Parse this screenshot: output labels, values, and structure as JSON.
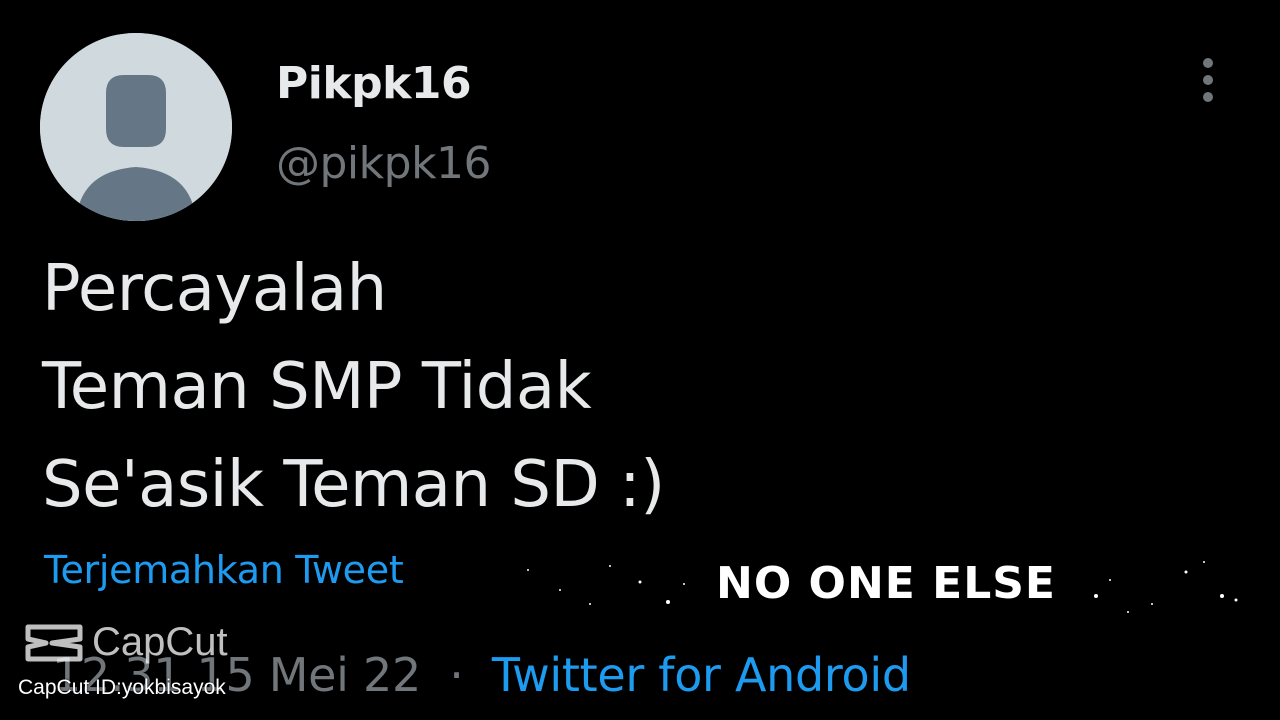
{
  "user": {
    "display_name": "Pikpk16",
    "handle": "@pikpk16"
  },
  "tweet": {
    "lines": [
      "Percayalah",
      "Teman SMP Tidak",
      "Se'asik Teman SD :)"
    ],
    "translate_label": "Terjemahkan Tweet",
    "time": "12.31",
    "date": "15 Mei 22",
    "separator": "·",
    "source": "Twitter for Android"
  },
  "overlay": {
    "caption": "NO ONE ELSE"
  },
  "watermark": {
    "brand": "CapCut",
    "id_text": "CapCut ID:yokbisayok"
  },
  "icons": {
    "more": "more-vertical-icon",
    "avatar": "default-avatar-icon",
    "capcut": "capcut-logo-icon"
  },
  "colors": {
    "background": "#000000",
    "text": "#e7e9ea",
    "muted": "#71767b",
    "link": "#1d9bf0"
  }
}
